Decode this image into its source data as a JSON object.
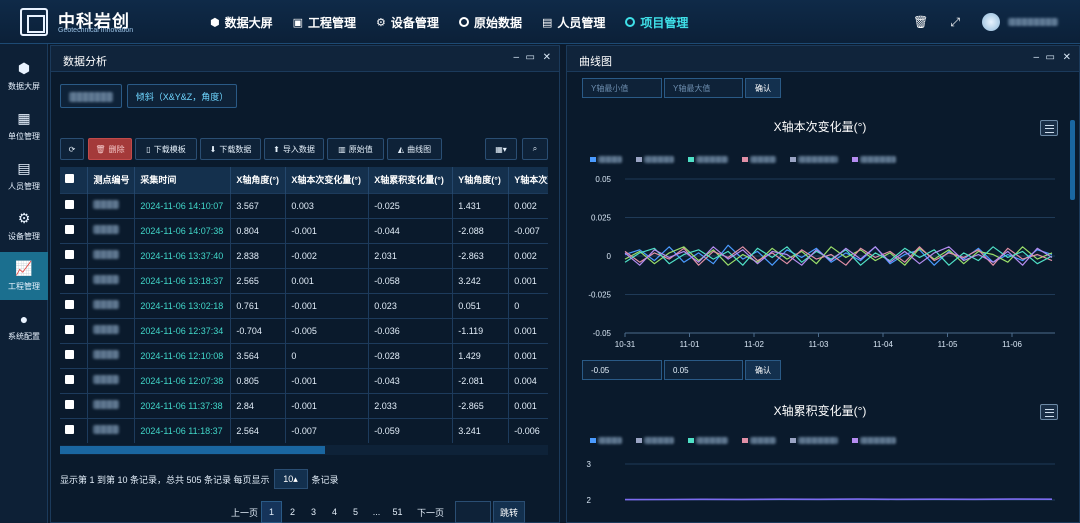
{
  "app": {
    "title": "中科岩创",
    "subtitle": "Geotechnical Innovation"
  },
  "nav": [
    {
      "label": "数据大屏",
      "icon": "cube-icon"
    },
    {
      "label": "工程管理",
      "icon": "monitor-icon"
    },
    {
      "label": "设备管理",
      "icon": "gear-icon"
    },
    {
      "label": "原始数据",
      "icon": "circle-icon"
    },
    {
      "label": "人员管理",
      "icon": "person-card-icon"
    },
    {
      "label": "项目管理",
      "icon": "circle-icon",
      "active": true
    }
  ],
  "sidebar": [
    {
      "label": "数据大屏",
      "icon": "cube-icon"
    },
    {
      "label": "单位管理",
      "icon": "calendar-icon"
    },
    {
      "label": "人员管理",
      "icon": "person-card-icon"
    },
    {
      "label": "设备管理",
      "icon": "gear-icon"
    },
    {
      "label": "工程管理",
      "icon": "trend-chart-icon",
      "active": true
    },
    {
      "label": "系统配置",
      "icon": "dots-icon"
    }
  ],
  "left_panel": {
    "title": "数据分析",
    "filter_label": "倾斜（X&Y&Z，角度）",
    "toolbar": {
      "delete": "删除",
      "download_template": "下载模板",
      "download_data": "下载数据",
      "import_data": "导入数据",
      "raw_value": "原始值",
      "curve": "曲线图"
    },
    "columns": [
      "测点编号",
      "采集时间",
      "X轴角度(°)",
      "X轴本次变化量(°)",
      "X轴累积变化量(°)",
      "Y轴角度(°)",
      "Y轴本次变"
    ],
    "rows": [
      [
        "2024-11-06 14:10:07",
        "3.567",
        "0.003",
        "-0.025",
        "1.431",
        "0.002"
      ],
      [
        "2024-11-06 14:07:38",
        "0.804",
        "-0.001",
        "-0.044",
        "-2.088",
        "-0.007"
      ],
      [
        "2024-11-06 13:37:40",
        "2.838",
        "-0.002",
        "2.031",
        "-2.863",
        "0.002"
      ],
      [
        "2024-11-06 13:18:37",
        "2.565",
        "0.001",
        "-0.058",
        "3.242",
        "0.001"
      ],
      [
        "2024-11-06 13:02:18",
        "0.761",
        "-0.001",
        "0.023",
        "0.051",
        "0"
      ],
      [
        "2024-11-06 12:37:34",
        "-0.704",
        "-0.005",
        "-0.036",
        "-1.119",
        "0.001"
      ],
      [
        "2024-11-06 12:10:08",
        "3.564",
        "0",
        "-0.028",
        "1.429",
        "0.001"
      ],
      [
        "2024-11-06 12:07:38",
        "0.805",
        "-0.001",
        "-0.043",
        "-2.081",
        "0.004"
      ],
      [
        "2024-11-06 11:37:38",
        "2.84",
        "-0.001",
        "2.033",
        "-2.865",
        "0.001"
      ],
      [
        "2024-11-06 11:18:37",
        "2.564",
        "-0.007",
        "-0.059",
        "3.241",
        "-0.006"
      ]
    ],
    "pager_text_a": "显示第 1 到第 10 条记录，总共 505 条记录 每页显示",
    "page_size": "10",
    "pager_text_b": "条记录",
    "pages": {
      "prev": "上一页",
      "p1": "1",
      "p2": "2",
      "p3": "3",
      "p4": "4",
      "p5": "5",
      "ellipsis": "...",
      "last": "51",
      "next": "下一页",
      "jump": "跳转"
    }
  },
  "right_panel": {
    "title": "曲线图",
    "ymin_placeholder": "Y轴最小值",
    "ymax_placeholder": "Y轴最大值",
    "confirm": "确认",
    "ymin_value": "-0.05",
    "ymax_value": "0.05"
  },
  "chart_data": [
    {
      "type": "line",
      "title": "X轴本次变化量(°)",
      "x_ticks": [
        "10-31",
        "11-01",
        "11-02",
        "11-03",
        "11-04",
        "11-05",
        "11-06"
      ],
      "y_ticks": [
        "0.05",
        "0.025",
        "0",
        "-0.025",
        "-0.05"
      ],
      "ylim": [
        -0.05,
        0.05
      ],
      "series_colors": [
        "#4a9bff",
        "#9adf6a",
        "#e08fa6",
        "#4fe0c6",
        "#b58cf0",
        "#ffb56a"
      ],
      "series_values": [
        [
          0.001,
          0.004,
          -0.003,
          0.006,
          -0.004,
          0.002,
          -0.005,
          0.007,
          -0.002,
          0.003,
          -0.006,
          0.004,
          -0.001,
          0.005,
          -0.004,
          0.002,
          -0.003,
          0.006,
          -0.005,
          0.001,
          0.004,
          -0.006,
          0.003,
          -0.002,
          0.005,
          -0.004,
          0.001,
          -0.003,
          0.004,
          0.001
        ],
        [
          -0.002,
          0.003,
          -0.005,
          0.002,
          0.006,
          -0.003,
          0.004,
          -0.006,
          0.001,
          -0.004,
          0.005,
          -0.002,
          0.003,
          -0.005,
          0.006,
          -0.001,
          0.004,
          -0.003,
          0.002,
          -0.006,
          0.005,
          -0.002,
          0.004,
          -0.005,
          0.003,
          0.001,
          -0.004,
          0.006,
          -0.002,
          0.002
        ],
        [
          0.003,
          -0.004,
          0.002,
          -0.002,
          0.005,
          -0.006,
          0.003,
          -0.001,
          0.006,
          -0.003,
          0.002,
          -0.005,
          0.004,
          -0.002,
          0.001,
          -0.006,
          0.005,
          -0.001,
          0.003,
          -0.004,
          0.006,
          -0.003,
          0.002,
          -0.001,
          0.004,
          -0.006,
          0.005,
          -0.002,
          0.001,
          -0.003
        ],
        [
          -0.004,
          0.002,
          0.005,
          -0.005,
          0.001,
          0.004,
          -0.002,
          0.003,
          -0.006,
          0.005,
          -0.001,
          0.006,
          -0.004,
          0.003,
          -0.002,
          0.004,
          -0.006,
          0.002,
          -0.003,
          0.005,
          -0.001,
          0.004,
          -0.006,
          0.002,
          -0.003,
          0.006,
          -0.001,
          0.003,
          -0.005,
          0.0
        ],
        [
          0.002,
          -0.006,
          0.004,
          -0.001,
          0.003,
          -0.004,
          0.006,
          -0.002,
          0.004,
          -0.005,
          0.003,
          0.001,
          -0.006,
          0.004,
          -0.003,
          0.005,
          -0.002,
          0.006,
          -0.004,
          0.003,
          -0.005,
          0.002,
          0.006,
          -0.003,
          0.001,
          -0.004,
          0.003,
          -0.006,
          0.005,
          -0.001
        ]
      ]
    },
    {
      "type": "line",
      "title": "X轴累积变化量(°)",
      "y_ticks": [
        "3",
        "2"
      ],
      "ylim": [
        1.5,
        3.2
      ],
      "series_colors": [
        "#7c6cf0"
      ],
      "series_values": [
        [
          2.01,
          2.015,
          2.02,
          2.018,
          2.022,
          2.02,
          2.025,
          2.02,
          2.023,
          2.02,
          2.024,
          2.022
        ]
      ]
    }
  ]
}
